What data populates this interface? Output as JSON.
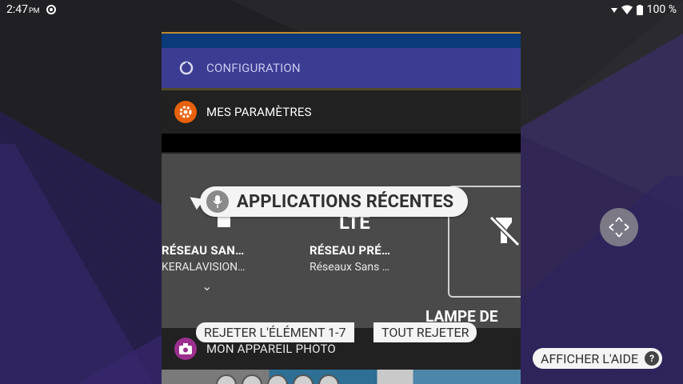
{
  "status_bar": {
    "time": "2:47",
    "ampm": "PM",
    "battery": "100 %"
  },
  "recents": {
    "configuration_label": "CONFIGURATION",
    "settings_label": "MES PARAMÈTRES",
    "tiles": [
      {
        "title": "RÉSEAU SAN…",
        "subtitle": "KERALAVISION…"
      },
      {
        "title": "RÉSEAU PRÉ…",
        "subtitle": "Réseaux Sans …"
      }
    ],
    "lte_glyph": "LTE",
    "lamp_label": "LAMPE DE",
    "camera_label": "MON APPAREIL PHOTO"
  },
  "overlay": {
    "recent_apps_label": "APPLICATIONS RÉCENTES",
    "reject_label": "REJETER L'ÉLÉMENT 1-7",
    "reject_all_label": "TOUT REJETER",
    "help_label": "AFFICHER L'AIDE",
    "help_icon_glyph": "?"
  }
}
